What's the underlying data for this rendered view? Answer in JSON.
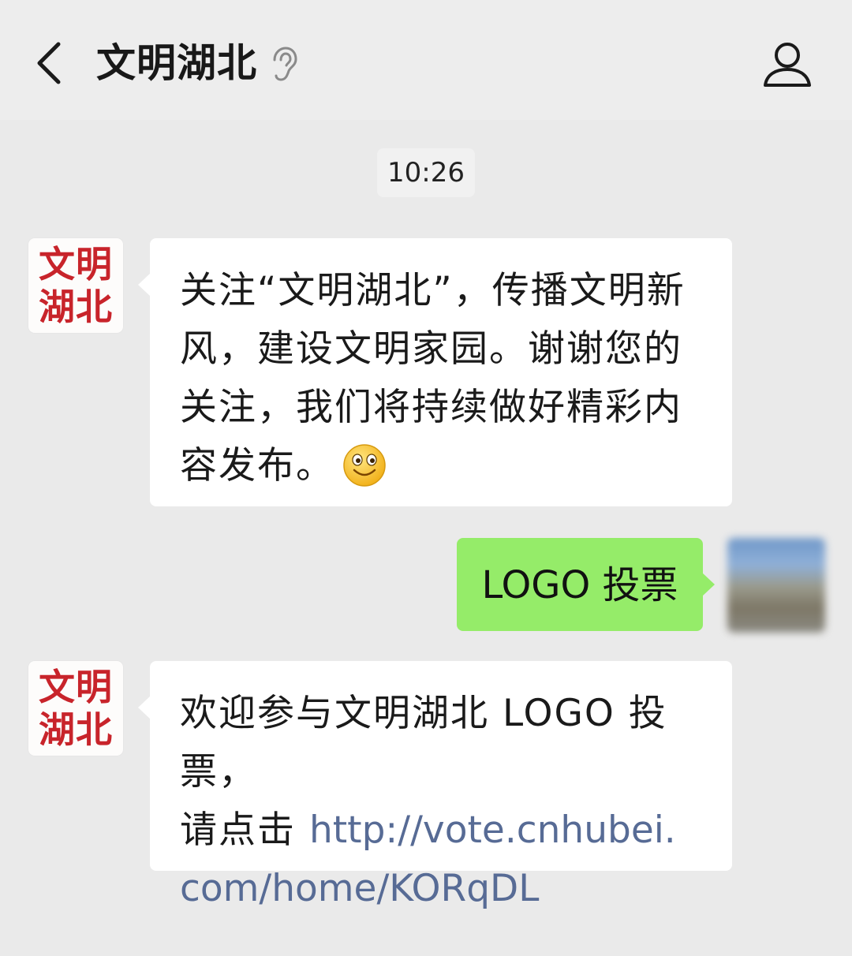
{
  "header": {
    "title": "文明湖北",
    "back_icon": "chevron-left-icon",
    "profile_icon": "person-icon",
    "listen_icon": "ear-icon"
  },
  "chat": {
    "timestamp": "10:26",
    "avatar_text": "文明\n湖北",
    "messages": [
      {
        "direction": "in",
        "text": "关注“文明湖北”，传播文明新\n风，建设文明家园。谢谢您的\n关注，我们将持续做好精彩内\n容发布。",
        "emoji": "smile-emoji-icon"
      },
      {
        "direction": "out",
        "text": "LOGO 投票"
      },
      {
        "direction": "in",
        "text_prefix": "欢迎参与文明湖北 LOGO 投票，\n请点击 ",
        "link_line1": "http://vote.cnhubei.",
        "link_line2": "com/home/KORqDL"
      }
    ]
  },
  "colors": {
    "outgoing_bubble": "#95ec69",
    "incoming_bubble": "#ffffff",
    "link": "#576b95",
    "avatar_text": "#c8242b",
    "background": "#eaeaea"
  }
}
